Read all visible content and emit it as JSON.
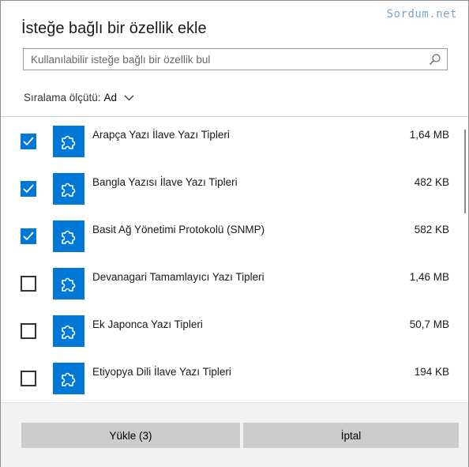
{
  "watermark": "Sordum.net",
  "dialog": {
    "title": "İsteğe bağlı bir özellik ekle",
    "search": {
      "placeholder": "Kullanılabilir isteğe bağlı bir özellik bul"
    },
    "sort": {
      "label": "Sıralama ölçütü:",
      "value": "Ad"
    }
  },
  "features": [
    {
      "name": "Arapça Yazı İlave Yazı Tipleri",
      "size": "1,64 MB",
      "checked": true
    },
    {
      "name": "Bangla Yazısı İlave Yazı Tipleri",
      "size": "482 KB",
      "checked": true
    },
    {
      "name": "Basit Ağ Yönetimi Protokolü (SNMP)",
      "size": "582 KB",
      "checked": true
    },
    {
      "name": "Devanagari Tamamlayıcı Yazı Tipleri",
      "size": "1,46 MB",
      "checked": false
    },
    {
      "name": "Ek Japonca Yazı Tipleri",
      "size": "50,7 MB",
      "checked": false
    },
    {
      "name": "Etiyopya Dili İlave Yazı Tipleri",
      "size": "194 KB",
      "checked": false
    }
  ],
  "buttons": {
    "install": "Yükle (3)",
    "cancel": "İptal"
  },
  "colors": {
    "accent": "#0078d7",
    "button": "#cccccc",
    "footer": "#f2f2f2"
  }
}
